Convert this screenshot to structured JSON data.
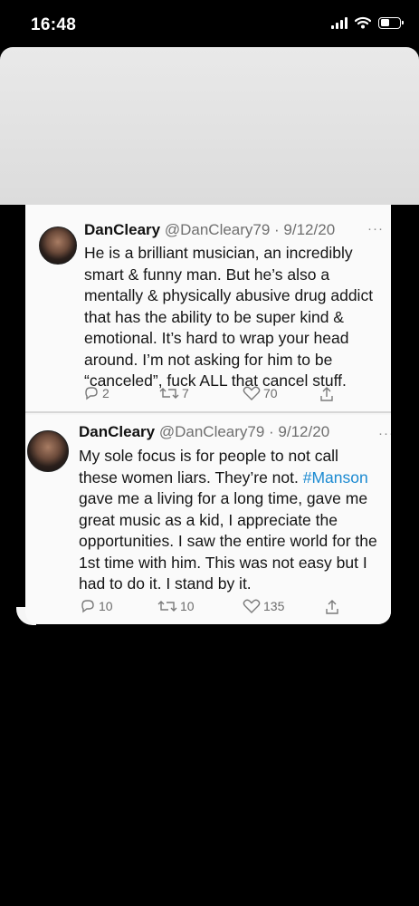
{
  "status_bar": {
    "time": "16:48"
  },
  "tweets": [
    {
      "name": "DanCleary",
      "handle": "@DanCleary79 · 9/12/20",
      "more": "···",
      "body_lines": [
        "He is a brilliant musician, an incredibly",
        "smart & funny man. But he’s also a",
        "mentally & physically abusive drug addict",
        "that has the ability to be super kind &",
        "emotional. It’s hard to wrap your head",
        "around. I’m not asking for him to be",
        "“canceled”, fuck ALL that cancel stuff."
      ],
      "replies": "2",
      "retweets": "7",
      "likes": "70"
    },
    {
      "name": "DanCleary",
      "handle": "@DanCleary79 · 9/12/20",
      "more": "···",
      "body_line_1": "My sole focus is for people to not call",
      "body_line_2_a": "these women liars. They’re not. ",
      "hashtag": "#Manson",
      "body_lines_rest": [
        "gave me a living for a long time, gave me",
        "great music as a kid, I appreciate the",
        "opportunities. I saw the entire world for the",
        "1st time with him. This was not easy but I",
        "had to do it. I stand by it."
      ],
      "replies": "10",
      "retweets": "10",
      "likes": "135"
    }
  ],
  "colors": {
    "hashtag": "#1b8ad1",
    "meta_gray": "#6f6f6f",
    "background": "#000000"
  }
}
